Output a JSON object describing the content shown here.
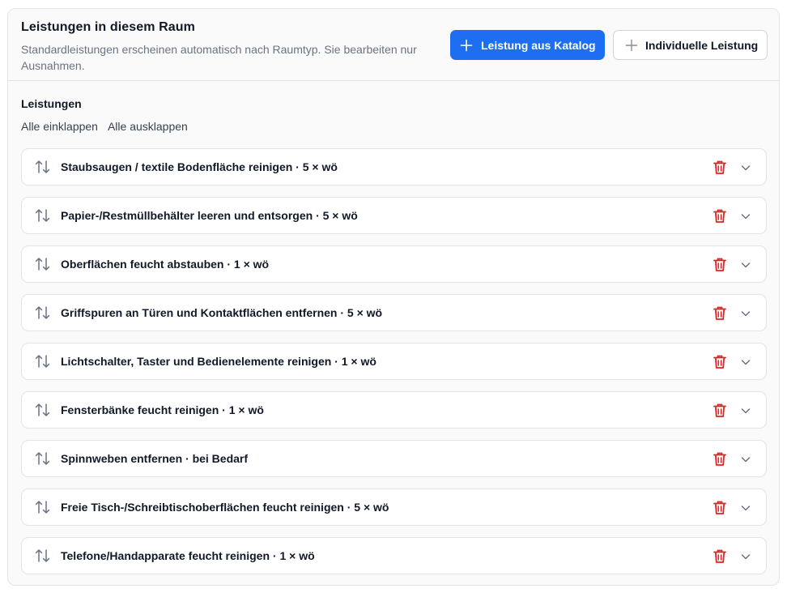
{
  "header": {
    "title": "Leistungen in diesem Raum",
    "description": "Standardleistungen erscheinen automatisch nach Raumtyp. Sie bearbeiten nur Ausnahmen.",
    "btn_catalog": "Leistung aus Katalog",
    "btn_custom": "Individuelle Leistung"
  },
  "section": {
    "label": "Leistungen",
    "collapse_all": "Alle einklappen",
    "expand_all": "Alle ausklappen"
  },
  "colors": {
    "primary": "#1d6ef0",
    "danger": "#dc2626"
  },
  "services": [
    {
      "label": "Staubsaugen / textile Bodenfläche reinigen · 5 × wö"
    },
    {
      "label": "Papier-/Restmüllbehälter leeren und entsorgen · 5 × wö"
    },
    {
      "label": "Oberflächen feucht abstauben · 1 × wö"
    },
    {
      "label": "Griffspuren an Türen und Kontaktflächen entfernen · 5 × wö"
    },
    {
      "label": "Lichtschalter, Taster und Bedienelemente reinigen · 1 × wö"
    },
    {
      "label": "Fensterbänke feucht reinigen · 1 × wö"
    },
    {
      "label": "Spinnweben entfernen · bei Bedarf"
    },
    {
      "label": "Freie Tisch-/Schreibtischoberflächen feucht reinigen · 5 × wö"
    },
    {
      "label": "Telefone/Handapparate feucht reinigen · 1 × wö"
    }
  ]
}
